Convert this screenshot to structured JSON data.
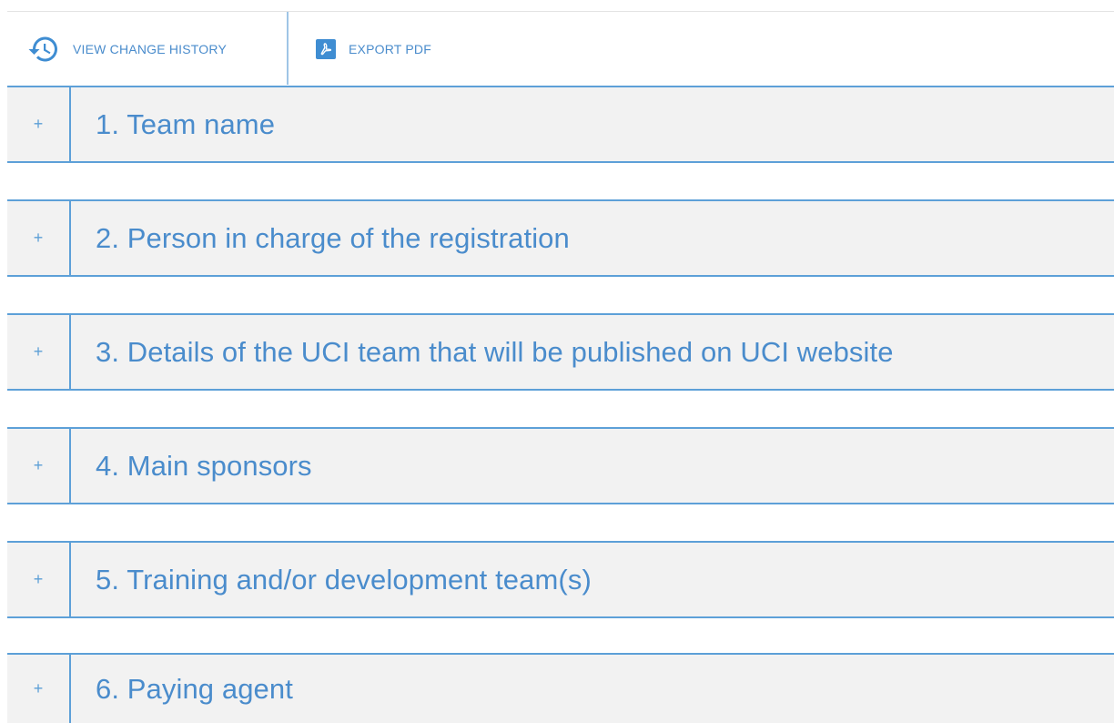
{
  "toolbar": {
    "history_label": "VIEW CHANGE HISTORY",
    "export_label": "EXPORT PDF"
  },
  "sections": [
    {
      "toggle": "+",
      "title": "1. Team name"
    },
    {
      "toggle": "+",
      "title": "2. Person in charge of the registration"
    },
    {
      "toggle": "+",
      "title": "3. Details of the UCI team that will be published on UCI website"
    },
    {
      "toggle": "+",
      "title": "4. Main sponsors"
    },
    {
      "toggle": "+",
      "title": "5. Training and/or development team(s)"
    },
    {
      "toggle": "+",
      "title": "6. Paying agent"
    }
  ],
  "icons": {
    "history": "history-icon",
    "pdf": "pdf-icon"
  },
  "colors": {
    "accent": "#4a8ccc",
    "border": "#5da0d8",
    "section_bg": "#f2f2f2",
    "pdf_badge": "#3f8dd2"
  }
}
